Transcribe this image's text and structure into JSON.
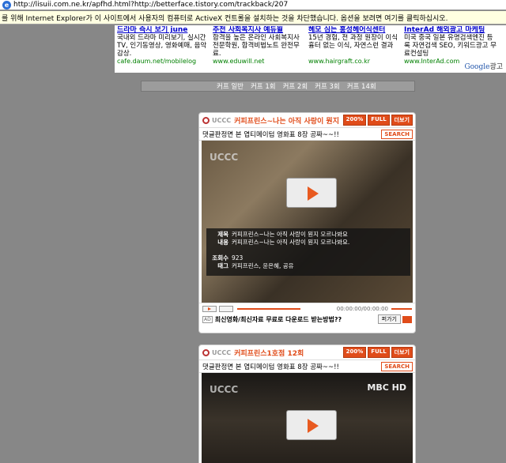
{
  "address_bar": {
    "url": "http://lisuii.com.ne.kr/apfhd.html?http://betterface.tistory.com/trackback/207"
  },
  "info_bar": {
    "text": "를 위해 Internet Explorer가 이 사이트에서 사용자의 컴퓨터로 ActiveX 컨트롤을 설치하는 것을 차단했습니다. 옵션을 보려면 여기를 클릭하십시오."
  },
  "ads": [
    {
      "title": "드라마 즉시 보기 june",
      "desc": "국내외 드라마 미리보기, 실시간 TV, 인기동영상, 영화예매, 음악감상.",
      "url": "cafe.daum.net/mobilelog"
    },
    {
      "title": "추천 사회복지사 예듀윌",
      "desc": "합격을 높은 온라인 사회복지사 전문학원, 합격비법노트 완전무료.",
      "url": "www.eduwill.net"
    },
    {
      "title": "헤모 심는 홍성헤어식센터",
      "desc": "15년 경험, 전 과정 원장이 이식 흉터 없는 이식, 자연스런 결과",
      "url": "www.hairgraft.co.kr"
    },
    {
      "title": "InterAd 해외광고 마케팅",
      "desc": "미국 중국 일본 유명검색엔진 등록 자연검색 SEO, 키워드광고 무료컨설팅",
      "url": "www.InterAd.com"
    }
  ],
  "google_ads": {
    "brand": "Google",
    "suffix": "광고"
  },
  "nav": {
    "items": [
      "커프 일반",
      "커프 1회",
      "커프 2회",
      "커프 3회",
      "커프 14회"
    ]
  },
  "player1": {
    "brand": "UCCC",
    "title": "커피프린스~나는 아직 사랑이 뭔지 모르나봐요",
    "buttons": [
      "200%",
      "FULL",
      "더보기"
    ],
    "subtitle": "댓글판정면 본 엽티메이텀 영화표 8장 공짜~~!!",
    "search_label": "SEARCH",
    "info": [
      {
        "key": "제목",
        "value": "커피프린스~나는 아직 사랑이 뭔지 모르나봐요"
      },
      {
        "key": "내용",
        "value": "커피프린스~나는 아직 사랑이 뭔지 모르나봐요."
      },
      {
        "key": "조회수",
        "value": "923"
      },
      {
        "key": "태그",
        "value": "커피프린스, 윤은혜, 공유"
      }
    ],
    "time": "00:00:00/00:00:00",
    "footer_text": "최신영화/최신자료 무료로 다운로드 받는방법??",
    "footer_button": "퍼가기",
    "ad_tag": "AD"
  },
  "player2": {
    "brand": "UCCC",
    "title": "커피프린스1호점 12회",
    "buttons": [
      "200%",
      "FULL",
      "더보기"
    ],
    "subtitle": "댓글판정면 본 엽티메이텀 영화표 8장 공짜~~!!",
    "search_label": "SEARCH",
    "channel_logo": "MBC HD"
  }
}
